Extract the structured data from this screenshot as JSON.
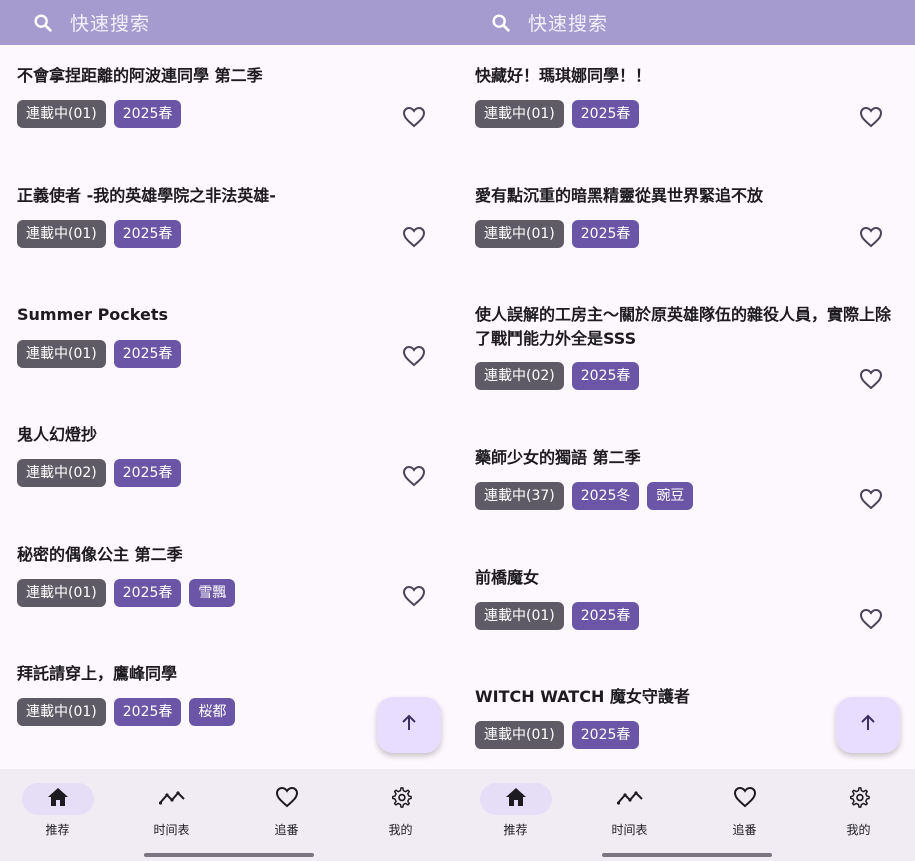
{
  "panels": [
    {
      "search": {
        "placeholder": "快速搜索"
      },
      "cards": [
        {
          "title": "不會拿捏距離的阿波連同學 第二季",
          "tags": [
            "連載中(01)",
            "2025春"
          ]
        },
        {
          "title": "正義使者 -我的英雄學院之非法英雄-",
          "tags": [
            "連載中(01)",
            "2025春"
          ]
        },
        {
          "title": "Summer Pockets",
          "tags": [
            "連載中(01)",
            "2025春"
          ]
        },
        {
          "title": "鬼人幻燈抄",
          "tags": [
            "連載中(02)",
            "2025春"
          ]
        },
        {
          "title": "秘密的偶像公主 第二季",
          "tags": [
            "連載中(01)",
            "2025春",
            "雪飄"
          ]
        },
        {
          "title": "拜託請穿上，鷹峰同學",
          "tags": [
            "連載中(01)",
            "2025春",
            "桜都"
          ]
        }
      ],
      "nav": [
        {
          "label": "推荐",
          "icon": "home-icon",
          "active": true
        },
        {
          "label": "时间表",
          "icon": "trending-icon",
          "active": false
        },
        {
          "label": "追番",
          "icon": "heart-icon",
          "active": false
        },
        {
          "label": "我的",
          "icon": "gear-icon",
          "active": false
        }
      ]
    },
    {
      "search": {
        "placeholder": "快速搜索"
      },
      "cards": [
        {
          "title": "快藏好！瑪琪娜同學！！",
          "tags": [
            "連載中(01)",
            "2025春"
          ]
        },
        {
          "title": "愛有點沉重的暗黑精靈從異世界緊追不放",
          "tags": [
            "連載中(01)",
            "2025春"
          ]
        },
        {
          "title": "使人誤解的工房主～關於原英雄隊伍的雜役人員，實際上除了戰鬥能力外全是SSS",
          "tags": [
            "連載中(02)",
            "2025春"
          ]
        },
        {
          "title": "藥師少女的獨語 第二季",
          "tags": [
            "連載中(37)",
            "2025冬",
            "豌豆"
          ]
        },
        {
          "title": "前橋魔女",
          "tags": [
            "連載中(01)",
            "2025春"
          ]
        },
        {
          "title": "WITCH WATCH 魔女守護者",
          "tags": [
            "連載中(01)",
            "2025春"
          ]
        }
      ],
      "nav": [
        {
          "label": "推荐",
          "icon": "home-icon",
          "active": true
        },
        {
          "label": "时间表",
          "icon": "trending-icon",
          "active": false
        },
        {
          "label": "追番",
          "icon": "heart-icon",
          "active": false
        },
        {
          "label": "我的",
          "icon": "gear-icon",
          "active": false
        }
      ]
    }
  ],
  "colors": {
    "accent": "#6a55a6",
    "search_bar": "#a69bcf",
    "status_tag": "#5f5b66",
    "background": "#fdf7fe",
    "fab": "#e9ddff",
    "navbar": "#f1ecf4"
  }
}
